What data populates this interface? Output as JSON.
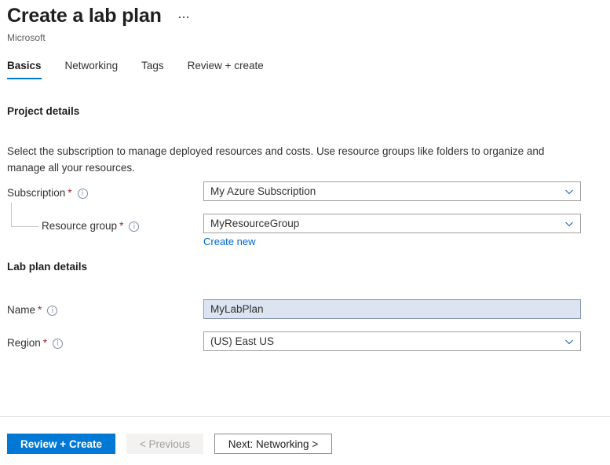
{
  "header": {
    "title": "Create a lab plan",
    "subtitle": "Microsoft",
    "more_actions_label": "..."
  },
  "tabs": [
    {
      "label": "Basics",
      "active": true
    },
    {
      "label": "Networking",
      "active": false
    },
    {
      "label": "Tags",
      "active": false
    },
    {
      "label": "Review + create",
      "active": false
    }
  ],
  "project_details": {
    "heading": "Project details",
    "description": "Select the subscription to manage deployed resources and costs. Use resource groups like folders to organize and manage all your resources.",
    "subscription": {
      "label": "Subscription",
      "required_marker": "*",
      "value": "My Azure Subscription",
      "icon": "info-icon",
      "chevron": "chevron-down-icon"
    },
    "resource_group": {
      "label": "Resource group",
      "required_marker": "*",
      "value": "MyResourceGroup",
      "icon": "info-icon",
      "chevron": "chevron-down-icon",
      "create_new_link": "Create new"
    }
  },
  "lab_plan_details": {
    "heading": "Lab plan details",
    "name": {
      "label": "Name",
      "required_marker": "*",
      "value": "MyLabPlan",
      "icon": "info-icon"
    },
    "region": {
      "label": "Region",
      "required_marker": "*",
      "value": "(US) East US",
      "icon": "info-icon",
      "chevron": "chevron-down-icon"
    }
  },
  "footer": {
    "review_create_label": "Review + Create",
    "previous_label": "< Previous",
    "next_label": "Next: Networking >"
  },
  "colors": {
    "accent": "#0078d4",
    "link": "#0066cc",
    "required": "#a4262c",
    "field_highlight": "#dce4f1",
    "border": "#a19f9d"
  }
}
